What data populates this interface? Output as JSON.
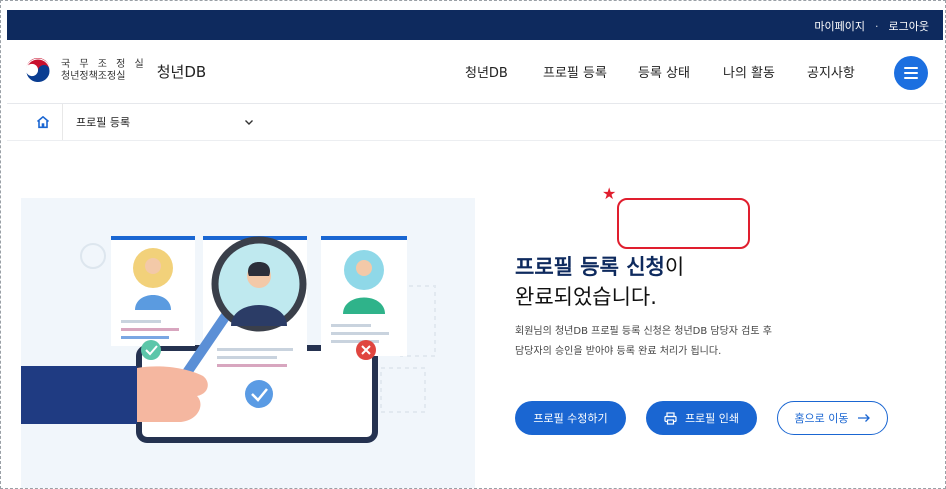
{
  "topbar": {
    "mypage": "마이페이지",
    "separator": "·",
    "logout": "로그아웃"
  },
  "header": {
    "org_line1": "국 무 조 정 실",
    "org_line2": "청년정책조정실",
    "brand": "청년DB",
    "nav": [
      "청년DB",
      "프로필 등록",
      "등록 상태",
      "나의 활동",
      "공지사항"
    ]
  },
  "breadcrumb": {
    "current": "프로필 등록"
  },
  "main": {
    "title_highlight": "프로필 등록 신청",
    "title_suffix": "이",
    "title_line2": "완료되었습니다.",
    "desc_line1": "회원님의 청년DB 프로필 등록 신청은 청년DB 담당자 검토 후",
    "desc_line2": "담당자의 승인을 받아야 등록 완료 처리가 됩니다.",
    "btn_edit": "프로필 수정하기",
    "btn_print": "프로필 인쇄",
    "btn_home": "홈으로 이동"
  },
  "annotation": {
    "star": "★"
  },
  "colors": {
    "navy": "#0e2a5e",
    "accent": "#1a66d2",
    "highlight": "#e01e2e"
  }
}
